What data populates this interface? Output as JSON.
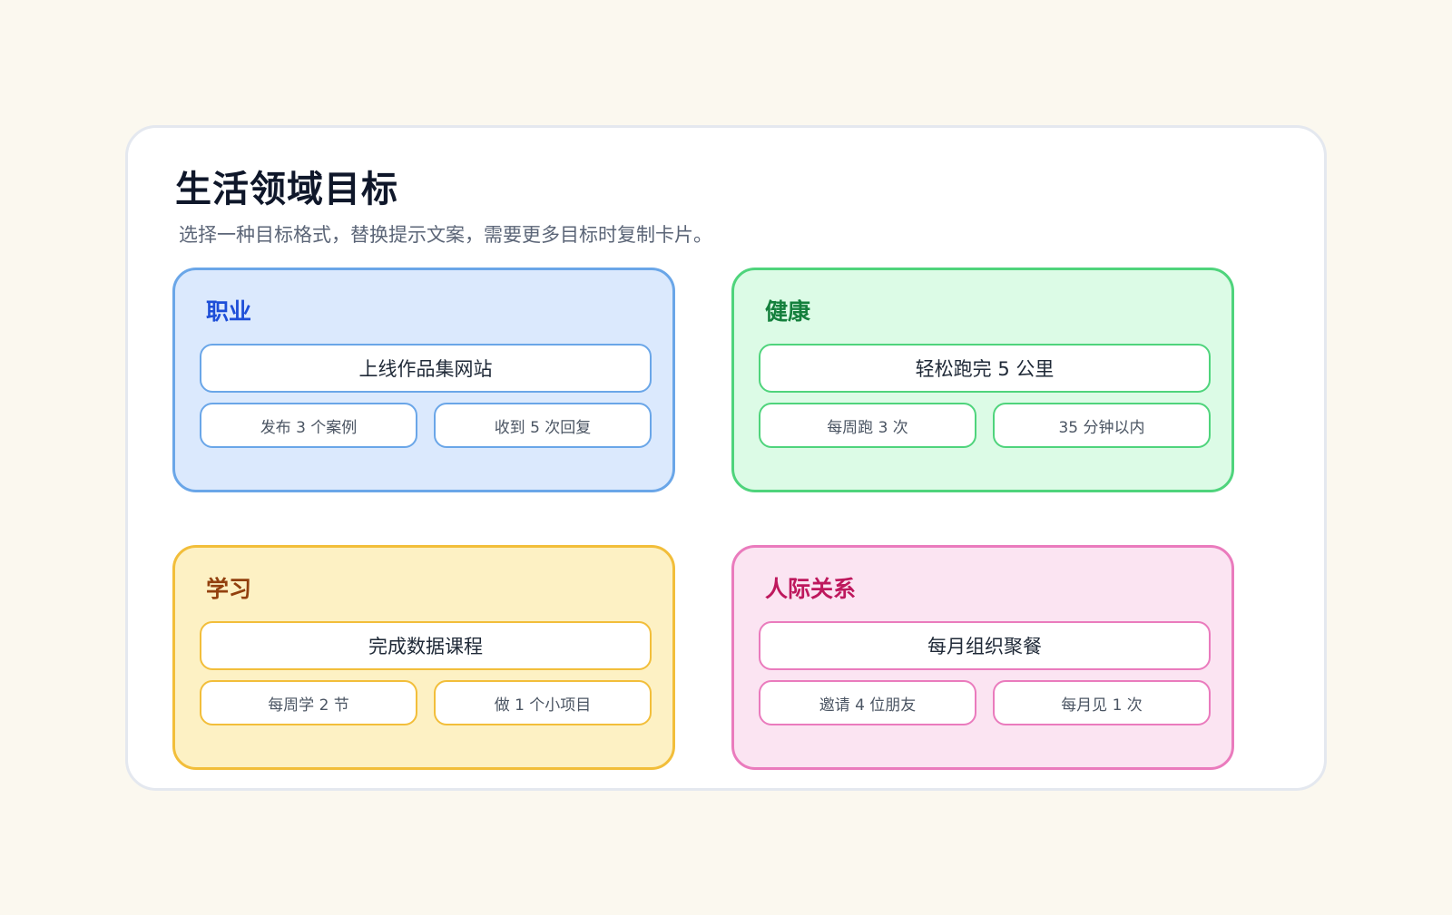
{
  "header": {
    "title": "生活领域目标",
    "subtitle": "选择一种目标格式，替换提示文案，需要更多目标时复制卡片。"
  },
  "areas": [
    {
      "title": "职业",
      "goal": "上线作品集网站",
      "metrics": [
        "发布 3 个案例",
        "收到 5 次回复"
      ],
      "colors": {
        "border": "#6aa6e8",
        "fill": "#dbe9fd",
        "title": "#1d4ed8"
      }
    },
    {
      "title": "健康",
      "goal": "轻松跑完 5 公里",
      "metrics": [
        "每周跑 3 次",
        "35 分钟以内"
      ],
      "colors": {
        "border": "#4fd47c",
        "fill": "#dcfbe6",
        "title": "#15803d"
      }
    },
    {
      "title": "学习",
      "goal": "完成数据课程",
      "metrics": [
        "每周学 2 节",
        "做 1 个小项目"
      ],
      "colors": {
        "border": "#f2be3a",
        "fill": "#fdf1c4",
        "title": "#92400e"
      }
    },
    {
      "title": "人际关系",
      "goal": "每月组织聚餐",
      "metrics": [
        "邀请 4 位朋友",
        "每月见 1 次"
      ],
      "colors": {
        "border": "#ea7bbd",
        "fill": "#fbe4f2",
        "title": "#be185d"
      }
    }
  ]
}
